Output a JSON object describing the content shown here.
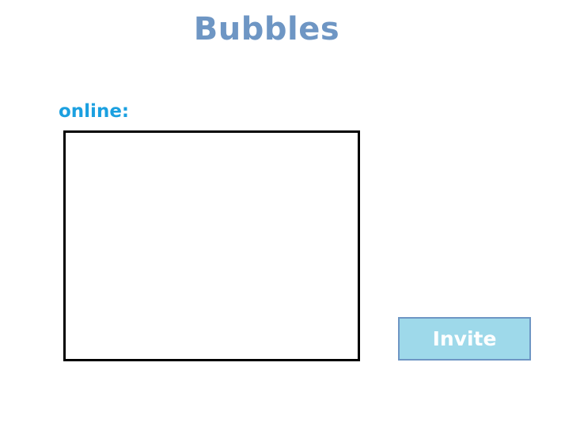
{
  "app": {
    "title": "Bubbles"
  },
  "online": {
    "label": "online:",
    "users": []
  },
  "actions": {
    "invite_label": "Invite"
  },
  "colors": {
    "title": "#6e96c4",
    "label": "#1ba0e0",
    "button_fill": "#9ed9ea",
    "button_border": "#6e96c4",
    "button_text": "#ffffff",
    "list_border": "#000000"
  }
}
